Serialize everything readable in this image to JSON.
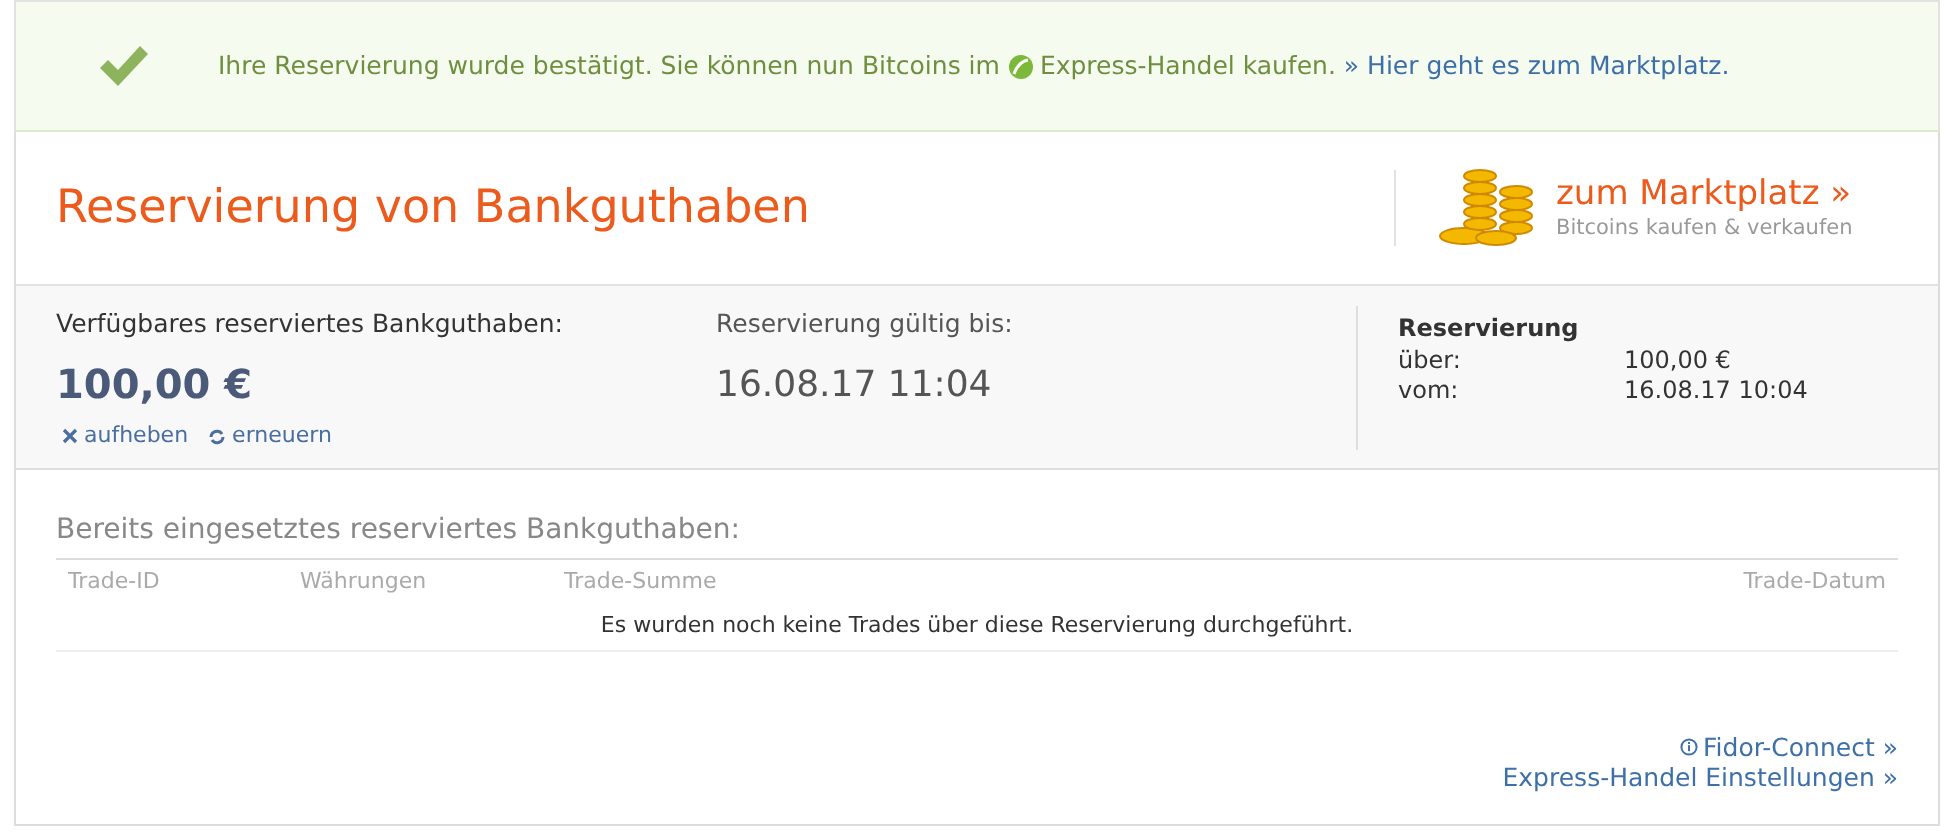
{
  "notice": {
    "text": "Ihre Reservierung wurde bestätigt. Sie können nun Bitcoins im",
    "product": "Express-Handel kaufen.",
    "link": "» Hier geht es zum Marktplatz."
  },
  "header": {
    "title": "Reservierung von Bankguthaben",
    "market_link": "zum Marktplatz »",
    "market_sub": "Bitcoins kaufen & verkaufen"
  },
  "summary": {
    "available_label": "Verfügbares reserviertes Bankguthaben:",
    "available_amount": "100,00 €",
    "actions": [
      {
        "kind": "cancel",
        "label": "aufheben"
      },
      {
        "kind": "renew",
        "label": "erneuern"
      }
    ],
    "valid_label": "Reservierung gültig bis:",
    "valid_value": "16.08.17 11:04",
    "reservation": {
      "title": "Reservierung",
      "rows": [
        {
          "label": "über:",
          "value": "100,00 €"
        },
        {
          "label": "vom:",
          "value": "16.08.17 10:04"
        }
      ]
    }
  },
  "trades": {
    "title": "Bereits eingesetztes reserviertes Bankguthaben:",
    "columns": [
      "Trade-ID",
      "Währungen",
      "Trade-Summe",
      "Trade-Datum"
    ],
    "empty_message": "Es wurden noch keine Trades über diese Reservierung durchgeführt."
  },
  "footer_links": [
    {
      "kind": "info",
      "label": "Fidor-Connect »"
    },
    {
      "kind": "plain",
      "label": "Express-Handel Einstellungen »"
    }
  ]
}
